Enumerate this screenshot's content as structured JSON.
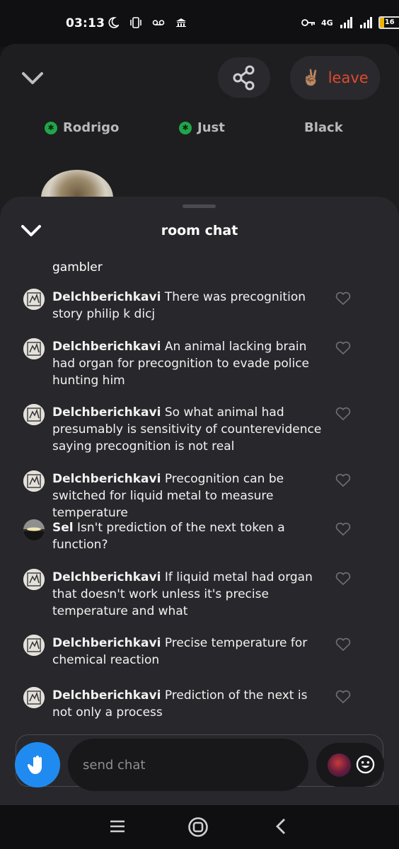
{
  "status_bar": {
    "time": "03:13",
    "network": "4G",
    "battery": "16"
  },
  "room": {
    "leave_label": "leave",
    "leave_emoji": "✌🏽",
    "speakers": [
      {
        "name": "Rodrigo",
        "verified": true
      },
      {
        "name": "Just",
        "verified": true
      },
      {
        "name": "Black",
        "verified": false
      }
    ]
  },
  "chat": {
    "title": "room chat",
    "continuation": "gambler",
    "messages": [
      {
        "user": "Delchberichkavi",
        "text": "There was precognition story philip k dicj"
      },
      {
        "user": "Delchberichkavi",
        "text": "An animal lacking brain had organ for precognition to evade police hunting him"
      },
      {
        "user": "Delchberichkavi",
        "text": "So what animal had presumably is sensitivity of counterevidence saying precognition is not real"
      },
      {
        "user": "Delchberichkavi",
        "text": "Precognition can be switched for liquid metal to measure temperature"
      },
      {
        "user": "Sel",
        "text": "Isn't prediction of the next token a function?"
      },
      {
        "user": "Delchberichkavi",
        "text": "If liquid metal had organ that doesn't work unless it's precise temperature and what"
      },
      {
        "user": "Delchberichkavi",
        "text": "Precise temperature for chemical reaction"
      },
      {
        "user": "Delchberichkavi",
        "text": "Prediction of the next is not only a process"
      }
    ],
    "input_placeholder": "send chat"
  },
  "colors": {
    "leave": "#e0492f",
    "raise_hand": "#1f8bf0",
    "verified": "#20a64a"
  }
}
